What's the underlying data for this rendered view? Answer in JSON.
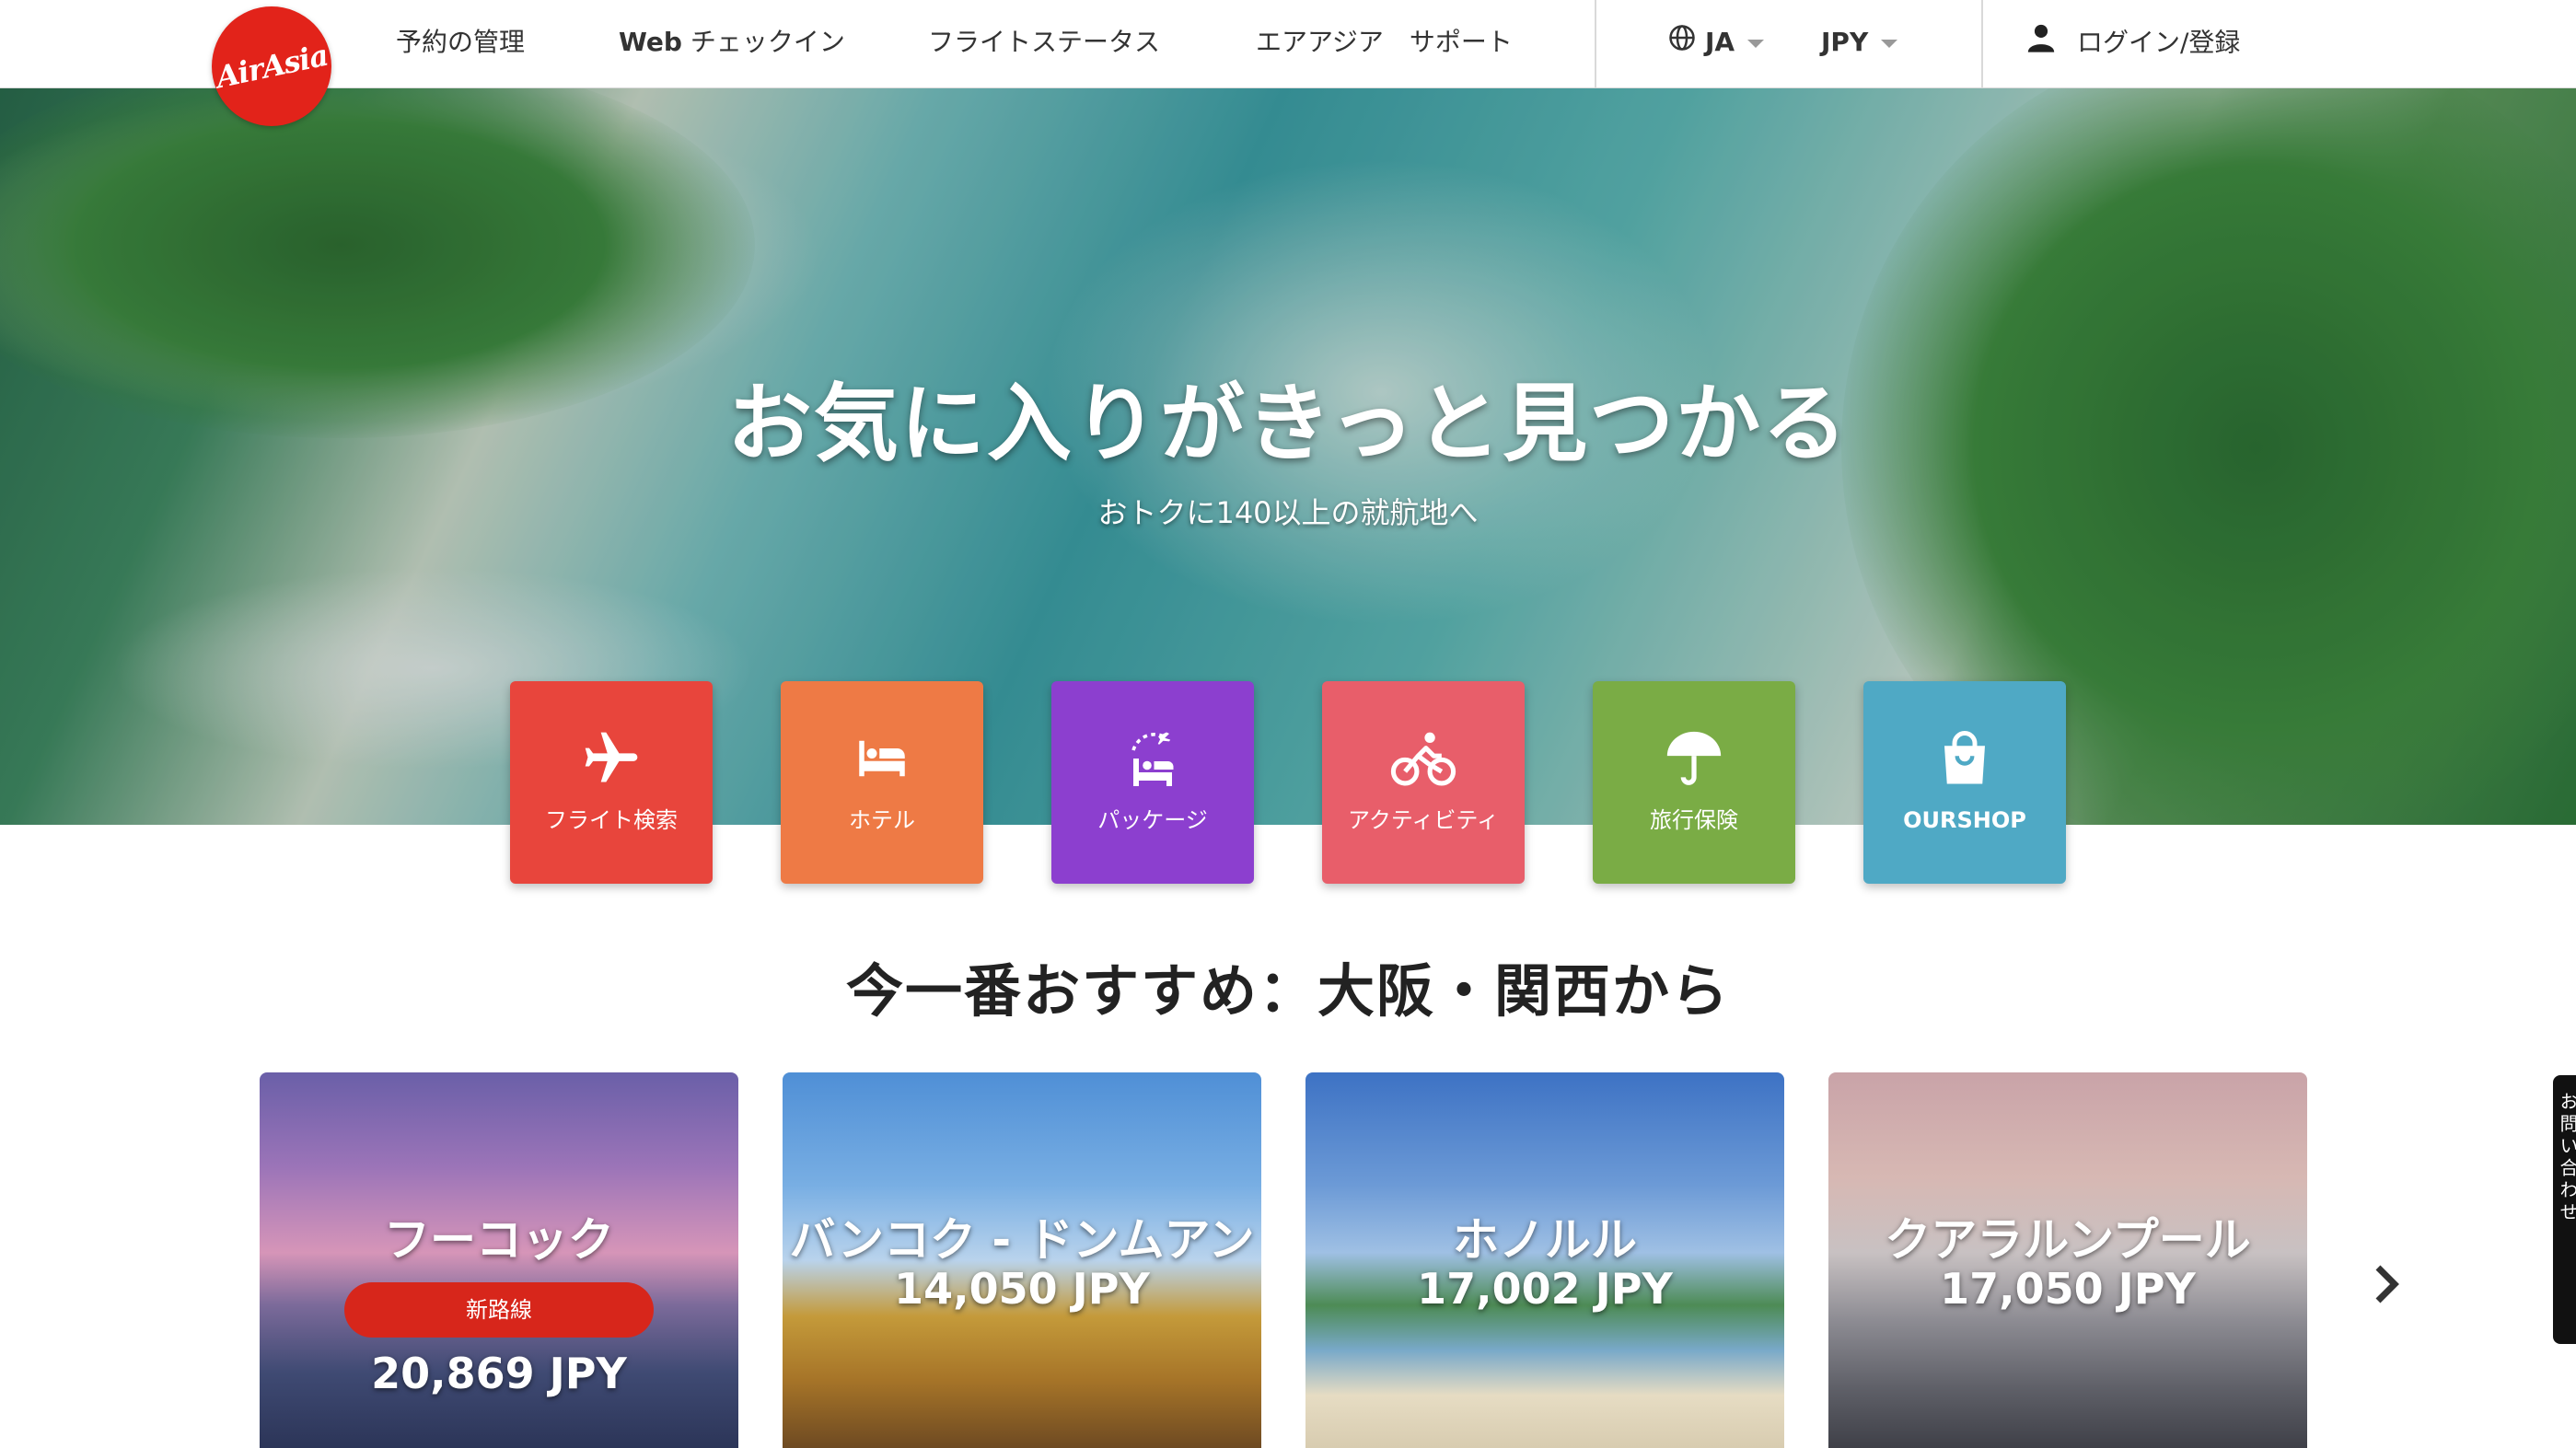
{
  "brand": {
    "logo_text": "AirAsia",
    "color": "#e2231a"
  },
  "nav": {
    "manage_booking": "予約の管理",
    "web_checkin_prefix": "Web",
    "web_checkin": "チェックイン",
    "flight_status": "フライトステータス",
    "support": "エアアジア　サポート",
    "language": "JA",
    "currency": "JPY",
    "login": "ログイン/登録"
  },
  "hero": {
    "title": "お気に入りがきっと見つかる",
    "subtitle": "おトクに140以上の就航地へ"
  },
  "tiles": [
    {
      "label": "フライト検索",
      "icon": "airplane-icon",
      "color": "#e8453c"
    },
    {
      "label": "ホテル",
      "icon": "bed-icon",
      "color": "#ee7a45"
    },
    {
      "label": "パッケージ",
      "icon": "package-travel-icon",
      "color": "#8c3fcf"
    },
    {
      "label": "アクティビティ",
      "icon": "bicycle-icon",
      "color": "#e85e6a"
    },
    {
      "label": "旅行保険",
      "icon": "umbrella-icon",
      "color": "#7aac45"
    },
    {
      "label": "OURSHOP",
      "icon": "shopping-bag-icon",
      "color": "#4fa9c5"
    }
  ],
  "section": {
    "title": "今一番おすすめ：大阪・関西から"
  },
  "destinations": [
    {
      "name": "フーコック",
      "badge": "新路線",
      "price": "20,869 JPY"
    },
    {
      "name": "バンコク - ドンムアン",
      "price": "14,050 JPY"
    },
    {
      "name": "ホノルル",
      "price": "17,002 JPY"
    },
    {
      "name": "クアラルンプール",
      "price": "17,050 JPY"
    }
  ],
  "side_tab": {
    "label": "お問い合わせ"
  }
}
